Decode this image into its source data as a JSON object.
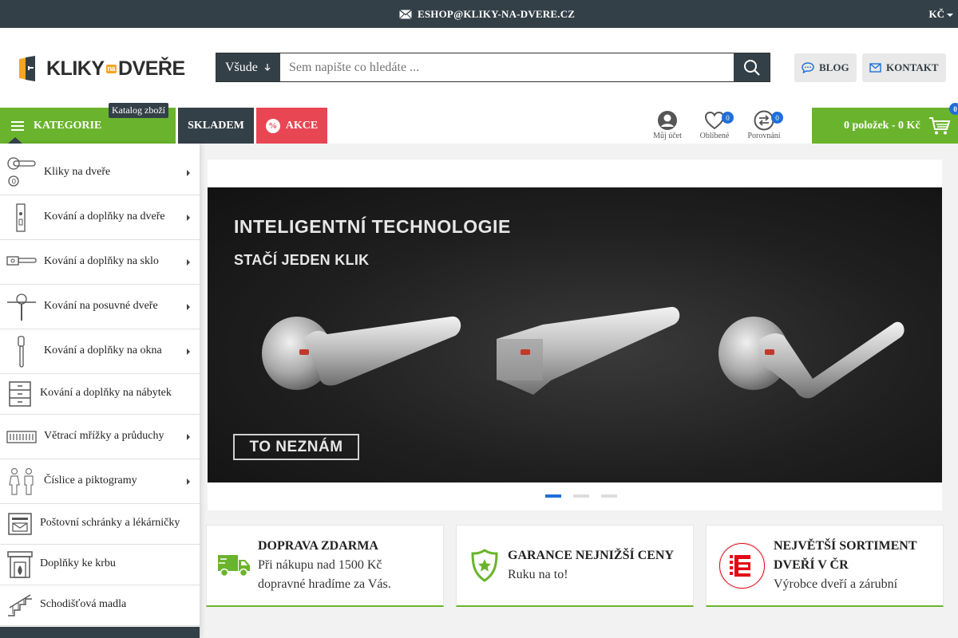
{
  "topbar": {
    "email": "ESHOP@KLIKY-NA-DVERE.CZ",
    "currency": "KČ"
  },
  "header": {
    "logo": {
      "part1": "KLIKY",
      "na": "na",
      "part2": "DVEŘE"
    },
    "search": {
      "scope": "Všude",
      "placeholder": "Sem napište co hledáte ..."
    },
    "blog_label": "BLOG",
    "contact_label": "KONTAKT"
  },
  "nav": {
    "categories_label": "KATEGORIE",
    "catalog_tooltip": "Katalog zboží",
    "in_stock_label": "SKLADEM",
    "sale_label": "AKCE",
    "sale_icon": "%",
    "account_label": "Můj účet",
    "favorites_label": "Oblíbené",
    "favorites_count": "0",
    "compare_label": "Porovnání",
    "compare_count": "0",
    "cart_label": "0 položek - 0 Kč",
    "cart_count": "0"
  },
  "categories": [
    {
      "label": "Kliky na dveře",
      "icon": "door-handle-icon",
      "has_submenu": true
    },
    {
      "label": "Kování a doplňky na dveře",
      "icon": "door-lock-icon",
      "has_submenu": true
    },
    {
      "label": "Kování a doplňky na sklo",
      "icon": "glass-handle-icon",
      "has_submenu": true
    },
    {
      "label": "Kování na posuvné dveře",
      "icon": "sliding-door-icon",
      "has_submenu": true
    },
    {
      "label": "Kování a doplňky na okna",
      "icon": "window-handle-icon",
      "has_submenu": true
    },
    {
      "label": "Kování a doplňky na nábytek",
      "icon": "furniture-icon",
      "has_submenu": false
    },
    {
      "label": "Větrací mřížky a průduchy",
      "icon": "vent-grille-icon",
      "has_submenu": true
    },
    {
      "label": "Číslice a piktogramy",
      "icon": "pictogram-icon",
      "has_submenu": true
    },
    {
      "label": "Poštovní schránky a lékárničky",
      "icon": "mailbox-icon",
      "has_submenu": false
    },
    {
      "label": "Doplňky ke krbu",
      "icon": "fireplace-icon",
      "has_submenu": false
    },
    {
      "label": "Schodišťová madla",
      "icon": "stair-rail-icon",
      "has_submenu": false
    }
  ],
  "banner": {
    "headline": "INTELIGENTNÍ TECHNOLOGIE",
    "subheadline": "STAČÍ JEDEN KLIK",
    "cta": "TO NEZNÁM",
    "slides": 3,
    "active_slide": 1
  },
  "features": [
    {
      "title": "DOPRAVA ZDARMA",
      "line1": "Při nákupu nad 1500 Kč",
      "line2": "dopravné hradíme za Vás.",
      "icon": "truck-icon"
    },
    {
      "title": "GARANCE NEJNIŽŠÍ CENY",
      "line1": "Ruku na to!",
      "icon": "shield-star-icon"
    },
    {
      "title": "NEJVĚTŠÍ SORTIMENT",
      "title2": "DVEŘÍ V ČR",
      "line1": "Výrobce dveří a zárubní",
      "icon": "brand-e-logo"
    }
  ],
  "colors": {
    "dark": "#344048",
    "green": "#6ab42d",
    "red": "#e94653",
    "blue": "#1e6fd9"
  }
}
